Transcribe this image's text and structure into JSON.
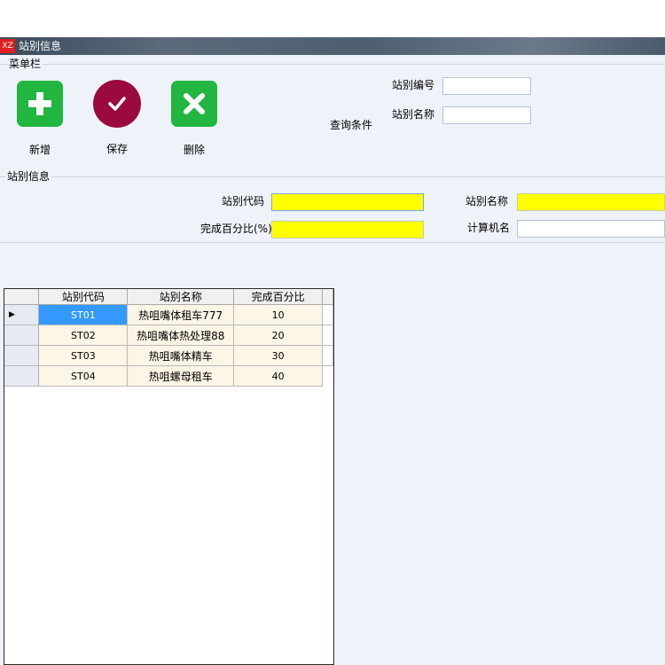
{
  "window": {
    "logo": "XZ",
    "title": "站别信息"
  },
  "toolbar": {
    "group_title": "菜单栏",
    "add_label": "新增",
    "save_label": "保存",
    "delete_label": "删除",
    "colors": {
      "add": "#21b63f",
      "save": "#9b0a3e",
      "delete": "#21b63f"
    }
  },
  "query": {
    "title": "查询条件",
    "station_no_label": "站别编号",
    "station_no_value": "",
    "station_name_label": "站别名称",
    "station_name_value": ""
  },
  "info": {
    "group_title": "站别信息",
    "code_label": "站别代码",
    "code_value": "",
    "name_label": "站别名称",
    "name_value": "",
    "percent_label": "完成百分比(%)",
    "percent_value": "",
    "computer_label": "计算机名",
    "computer_value": ""
  },
  "grid": {
    "columns": [
      "站别代码",
      "站别名称",
      "完成百分比"
    ],
    "rows": [
      {
        "code": "ST01",
        "name": "热咀嘴体租车777",
        "percent": "10"
      },
      {
        "code": "ST02",
        "name": "热咀嘴体热处理88",
        "percent": "20"
      },
      {
        "code": "ST03",
        "name": "热咀嘴体精车",
        "percent": "30"
      },
      {
        "code": "ST04",
        "name": "热咀螺母租车",
        "percent": "40"
      }
    ],
    "row_indicator": "▶"
  }
}
